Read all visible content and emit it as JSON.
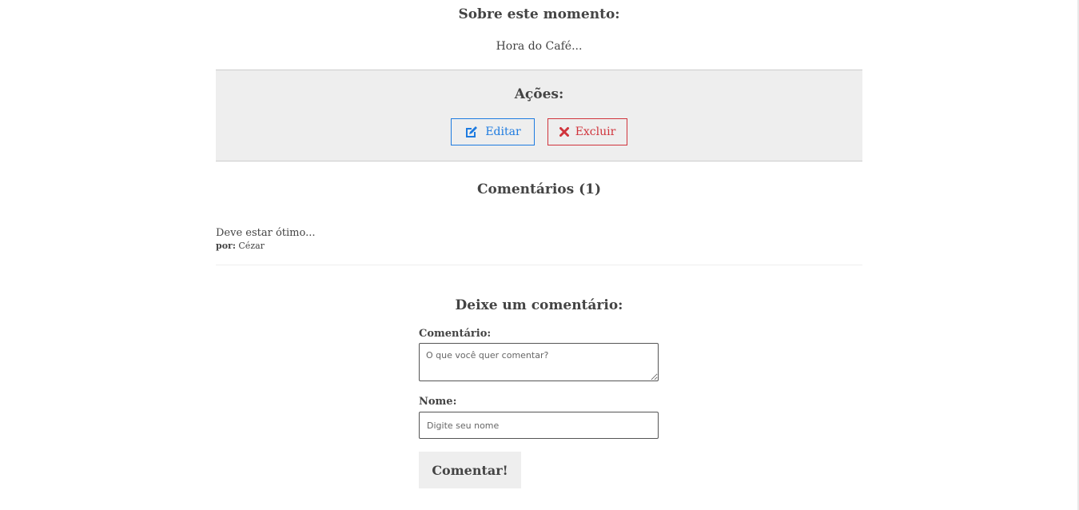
{
  "moment": {
    "about_title": "Sobre este momento:",
    "description": "Hora do Café..."
  },
  "actions": {
    "title": "Ações:",
    "edit_label": "Editar",
    "edit_icon": "edit-icon",
    "delete_label": "Excluir",
    "delete_icon": "close-icon",
    "edit_color": "#1e7be0",
    "delete_color": "#d0343c"
  },
  "comments": {
    "title": "Comentários (1)",
    "items": [
      {
        "text": "Deve estar ótimo...",
        "author_prefix": "por:",
        "author": "Cézar"
      }
    ]
  },
  "comment_form": {
    "title": "Deixe um comentário:",
    "comment_label": "Comentário:",
    "comment_placeholder": "O que você quer comentar?",
    "name_label": "Nome:",
    "name_placeholder": "Digite seu nome",
    "submit_label": "Comentar!"
  }
}
